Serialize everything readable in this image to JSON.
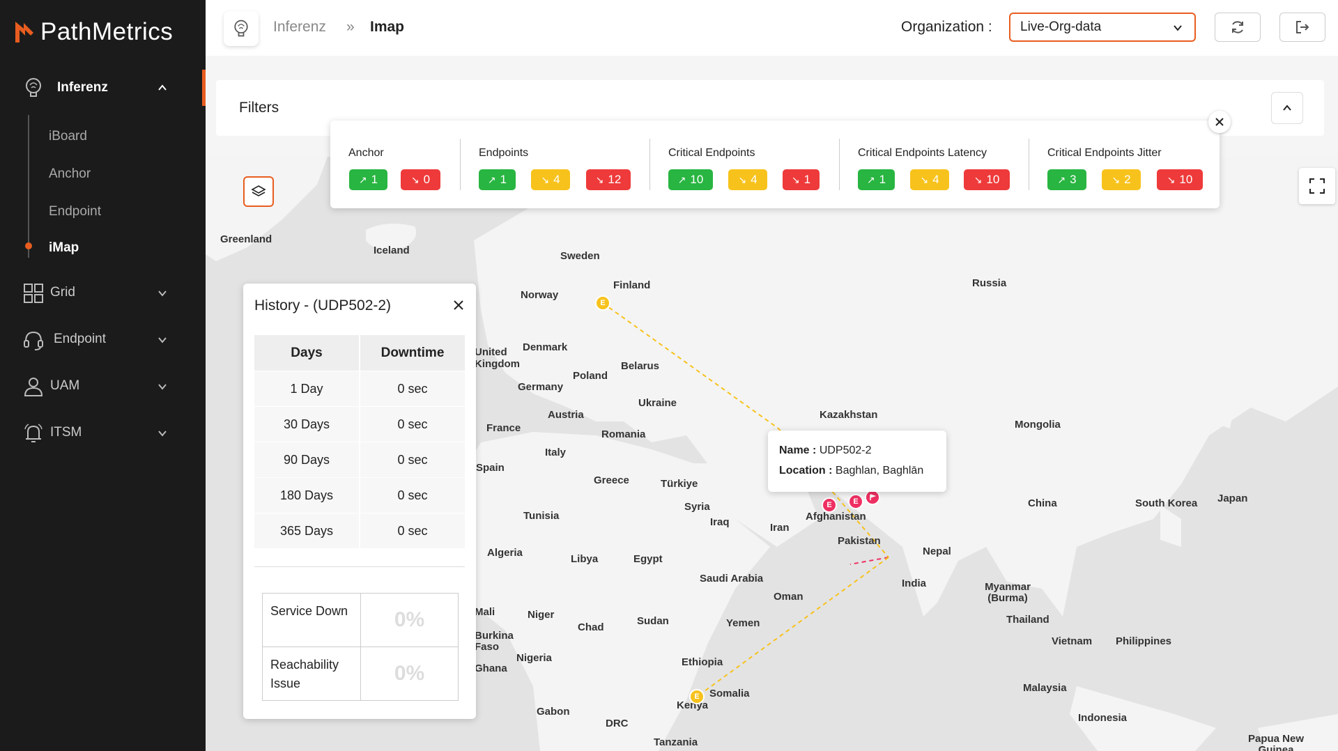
{
  "brand": {
    "name": "PathMetrics",
    "accent": "#e85d1f"
  },
  "sidebar": {
    "section": {
      "label": "Inferenz",
      "icon": "brain-bulb-icon"
    },
    "subitems": [
      {
        "label": "iBoard"
      },
      {
        "label": "Anchor"
      },
      {
        "label": "Endpoint"
      },
      {
        "label": "iMap"
      }
    ],
    "items": [
      {
        "label": "Grid",
        "icon": "grid-icon"
      },
      {
        "label": "Endpoint",
        "icon": "headset-icon"
      },
      {
        "label": "UAM",
        "icon": "user-icon"
      },
      {
        "label": "ITSM",
        "icon": "bell-icon"
      }
    ]
  },
  "header": {
    "breadcrumb": [
      "Inferenz",
      "Imap"
    ],
    "org_label": "Organization :",
    "org_value": "Live-Org-data"
  },
  "filters": {
    "title": "Filters"
  },
  "stats": [
    {
      "title": "Anchor",
      "pills": [
        {
          "color": "green",
          "value": "1"
        },
        {
          "color": "red",
          "value": "0"
        }
      ]
    },
    {
      "title": "Endpoints",
      "pills": [
        {
          "color": "green",
          "value": "1"
        },
        {
          "color": "yellow",
          "value": "4"
        },
        {
          "color": "red",
          "value": "12"
        }
      ]
    },
    {
      "title": "Critical Endpoints",
      "pills": [
        {
          "color": "green",
          "value": "10"
        },
        {
          "color": "yellow",
          "value": "4"
        },
        {
          "color": "red",
          "value": "1"
        }
      ]
    },
    {
      "title": "Critical Endpoints Latency",
      "pills": [
        {
          "color": "green",
          "value": "1"
        },
        {
          "color": "yellow",
          "value": "4"
        },
        {
          "color": "red",
          "value": "10"
        }
      ]
    },
    {
      "title": "Critical Endpoints Jitter",
      "pills": [
        {
          "color": "green",
          "value": "3"
        },
        {
          "color": "yellow",
          "value": "2"
        },
        {
          "color": "red",
          "value": "10"
        }
      ]
    }
  ],
  "history": {
    "title": "History - (UDP502-2)",
    "columns": [
      "Days",
      "Downtime"
    ],
    "rows": [
      [
        "1 Day",
        "0 sec"
      ],
      [
        "30 Days",
        "0 sec"
      ],
      [
        "90 Days",
        "0 sec"
      ],
      [
        "180 Days",
        "0 sec"
      ],
      [
        "365 Days",
        "0 sec"
      ]
    ],
    "metrics": [
      {
        "label": "Service Down",
        "value": "0%"
      },
      {
        "label": "Reachability Issue",
        "value": "0%"
      }
    ]
  },
  "tooltip": {
    "name_label": "Name :",
    "name_value": "UDP502-2",
    "location_label": "Location :",
    "location_value": "Baghlan, Baghlān"
  },
  "map": {
    "labels": [
      "Greenland",
      "Iceland",
      "Sweden",
      "Finland",
      "Norway",
      "Russia",
      "United Kingdom",
      "Denmark",
      "Belarus",
      "Poland",
      "Germany",
      "Ukraine",
      "Kazakhstan",
      "France",
      "Austria",
      "Romania",
      "Mongolia",
      "Italy",
      "Spain",
      "Greece",
      "Türkiye",
      "Syria",
      "Iraq",
      "Iran",
      "Afghanistan",
      "China",
      "South Korea",
      "Japan",
      "Pakistan",
      "Tunisia",
      "Nepal",
      "Algeria",
      "Libya",
      "Egypt",
      "Saudi Arabia",
      "India",
      "Oman",
      "Myanmar (Burma)",
      "Mali",
      "Niger",
      "Chad",
      "Sudan",
      "Yemen",
      "Thailand",
      "Burkina Faso",
      "Vietnam",
      "Philippines",
      "Nigeria",
      "Ghana",
      "Ethiopia",
      "Somalia",
      "Malaysia",
      "Kenya",
      "Gabon",
      "DRC",
      "Indonesia",
      "Tanzania",
      "Papua New Guinea"
    ],
    "marker_letter": "E"
  }
}
